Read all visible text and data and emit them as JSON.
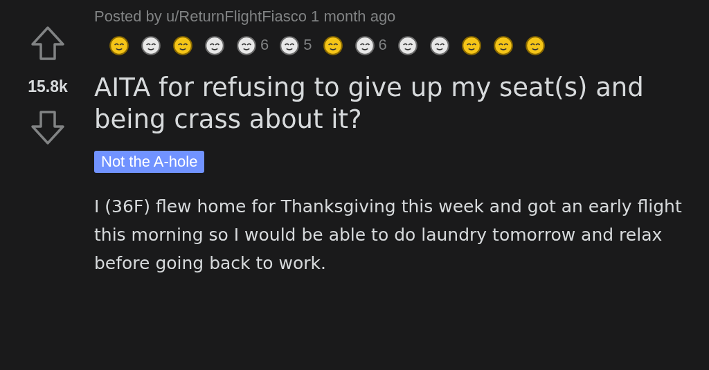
{
  "post": {
    "byline": "Posted by u/ReturnFlightFiasco 1 month ago",
    "awards": [
      {
        "kind": "gold"
      },
      {
        "kind": "silver"
      },
      {
        "kind": "gold"
      },
      {
        "kind": "silver"
      },
      {
        "kind": "silver",
        "count": "6"
      },
      {
        "kind": "silver",
        "count": "5"
      },
      {
        "kind": "gold"
      },
      {
        "kind": "silver",
        "count": "6"
      },
      {
        "kind": "silver"
      },
      {
        "kind": "silver"
      },
      {
        "kind": "gold"
      },
      {
        "kind": "gold"
      },
      {
        "kind": "gold"
      }
    ],
    "score": "15.8k",
    "title": "AITA for refusing to give up my seat(s) and being crass about it?",
    "flair": {
      "text": "Not the A-hole",
      "color": "#7193ff"
    },
    "body": "I (36F) flew home for Thanksgiving this week and got an early flight this morning so I would be able to do laundry tomorrow and relax before going back to work."
  }
}
